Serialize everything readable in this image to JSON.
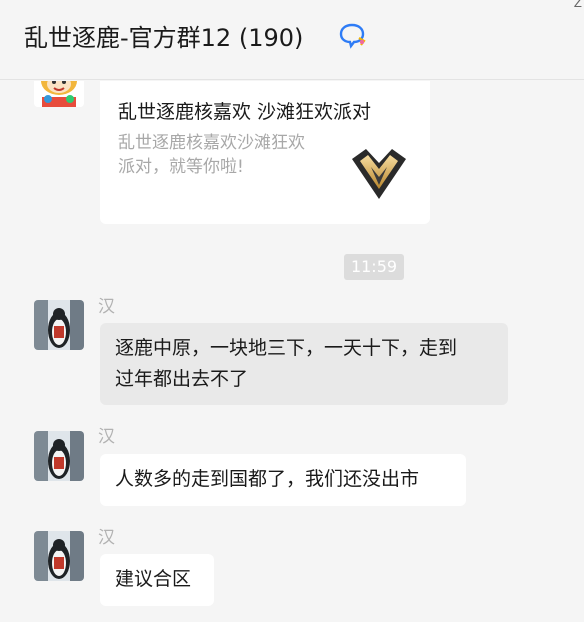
{
  "header": {
    "title": "乱世逐鹿-官方群12 (190)",
    "corner_mark": "Z"
  },
  "messages": {
    "card": {
      "title": "乱世逐鹿核嘉欢 沙滩狂欢派对",
      "desc_line1": "乱世逐鹿核嘉欢沙滩狂欢",
      "desc_line2": "派对，就等你啦!"
    },
    "time": "11:59",
    "m1": {
      "sender": "汉",
      "line1": "逐鹿中原，一块地三下，一天十下，走到",
      "line2": "过年都出去不了"
    },
    "m2": {
      "sender": "汉",
      "text": "人数多的走到国都了，我们还没出市"
    },
    "m3": {
      "sender": "汉",
      "text": "建议合区"
    }
  },
  "colors": {
    "background": "#f5f5f5",
    "bubble_white": "#ffffff",
    "bubble_grey": "#e9e9e9",
    "accent_icon": "#2e7cf6"
  },
  "icons": {
    "header": "group-chat-icon",
    "card_logo": "game-crest-logo",
    "avatar": "user-avatar"
  }
}
